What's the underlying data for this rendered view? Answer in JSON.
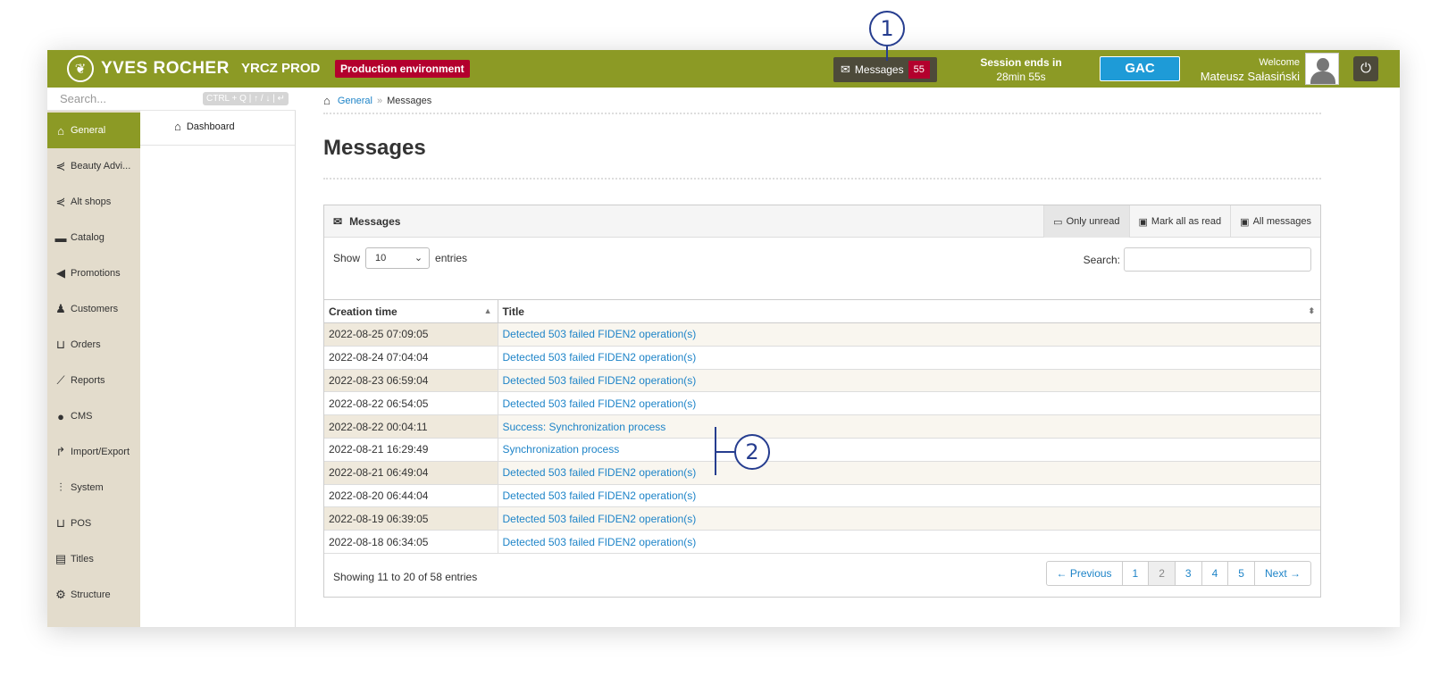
{
  "header": {
    "brand": "YVES ROCHER",
    "env_name": "YRCZ PROD",
    "env_badge": "Production environment",
    "messages_label": "Messages",
    "messages_count": "55",
    "session_label": "Session ends in",
    "session_time": "28min 55s",
    "store_button": "GAC",
    "welcome_label": "Welcome",
    "user_name": "Mateusz Sałasiński"
  },
  "sidebar": {
    "search_placeholder": "Search...",
    "search_shortcut": "CTRL + Q | ↑ / ↓ | ↵",
    "items": [
      {
        "label": "General",
        "icon": "home-icon"
      },
      {
        "label": "Beauty Advi...",
        "icon": "share-icon"
      },
      {
        "label": "Alt shops",
        "icon": "share-icon"
      },
      {
        "label": "Catalog",
        "icon": "folder-icon"
      },
      {
        "label": "Promotions",
        "icon": "megaphone-icon"
      },
      {
        "label": "Customers",
        "icon": "users-icon"
      },
      {
        "label": "Orders",
        "icon": "cart-icon"
      },
      {
        "label": "Reports",
        "icon": "chart-icon"
      },
      {
        "label": "CMS",
        "icon": "globe-icon"
      },
      {
        "label": "Import/Export",
        "icon": "share-arrow-icon"
      },
      {
        "label": "System",
        "icon": "sliders-icon"
      },
      {
        "label": "POS",
        "icon": "cart-icon"
      },
      {
        "label": "Titles",
        "icon": "id-card-icon"
      },
      {
        "label": "Structure",
        "icon": "cog-icon"
      }
    ],
    "sub_items": [
      {
        "label": "Dashboard",
        "icon": "home-icon"
      }
    ]
  },
  "breadcrumb": {
    "home_link": "General",
    "separator": "»",
    "current": "Messages"
  },
  "page": {
    "title": "Messages"
  },
  "panel": {
    "title": "Messages",
    "tabs": [
      {
        "label": "Only unread",
        "icon": "inbox-icon"
      },
      {
        "label": "Mark all as read",
        "icon": "inbox-icon"
      },
      {
        "label": "All messages",
        "icon": "inbox-icon"
      }
    ],
    "show_label": "Show",
    "entries_value": "10",
    "entries_label": "entries",
    "search_label": "Search:",
    "columns": [
      "Creation time",
      "Title"
    ],
    "rows": [
      {
        "time": "2022-08-25 07:09:05",
        "title": "Detected 503 failed FIDEN2 operation(s)"
      },
      {
        "time": "2022-08-24 07:04:04",
        "title": "Detected 503 failed FIDEN2 operation(s)"
      },
      {
        "time": "2022-08-23 06:59:04",
        "title": "Detected 503 failed FIDEN2 operation(s)"
      },
      {
        "time": "2022-08-22 06:54:05",
        "title": "Detected 503 failed FIDEN2 operation(s)"
      },
      {
        "time": "2022-08-22 00:04:11",
        "title": "Success: Synchronization process"
      },
      {
        "time": "2022-08-21 16:29:49",
        "title": "Synchronization process"
      },
      {
        "time": "2022-08-21 06:49:04",
        "title": "Detected 503 failed FIDEN2 operation(s)"
      },
      {
        "time": "2022-08-20 06:44:04",
        "title": "Detected 503 failed FIDEN2 operation(s)"
      },
      {
        "time": "2022-08-19 06:39:05",
        "title": "Detected 503 failed FIDEN2 operation(s)"
      },
      {
        "time": "2022-08-18 06:34:05",
        "title": "Detected 503 failed FIDEN2 operation(s)"
      }
    ],
    "showing_text": "Showing 11 to 20 of 58 entries",
    "pagination": [
      "← Previous",
      "1",
      "2",
      "3",
      "4",
      "5",
      "Next →"
    ],
    "current_page": "2"
  },
  "callouts": [
    "1",
    "2"
  ],
  "colors": {
    "accent": "#8c9a25",
    "badge": "#b3002d",
    "link": "#1e84c8",
    "gac": "#1e9bd7",
    "callout": "#263d8f"
  }
}
